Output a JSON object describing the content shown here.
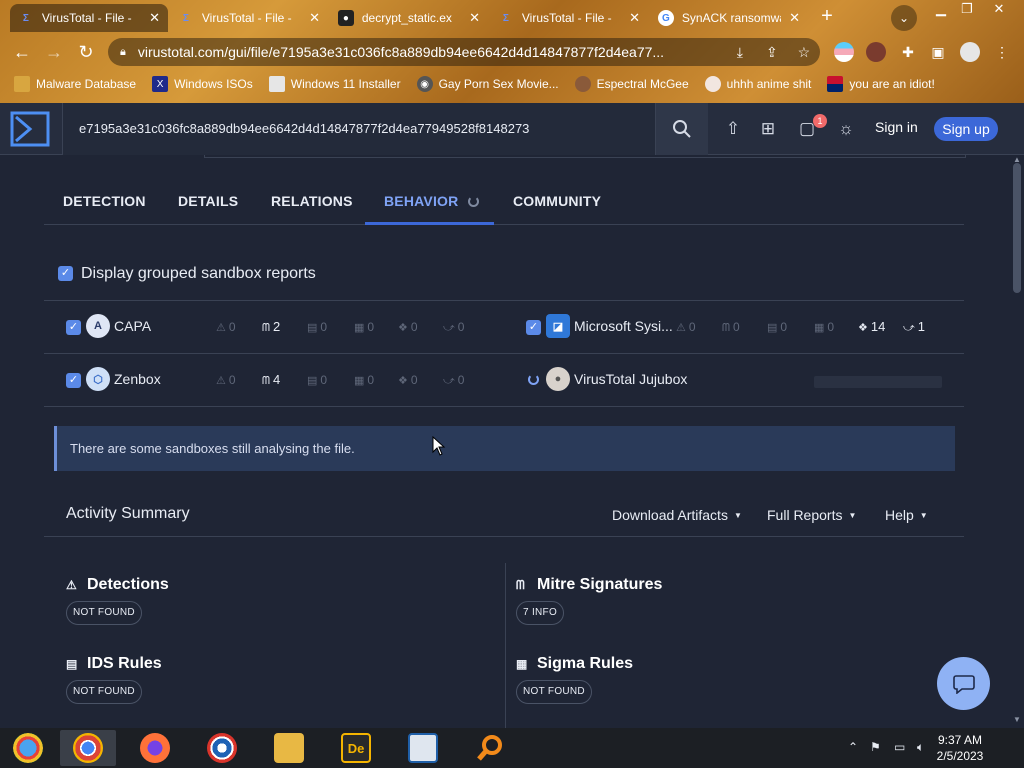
{
  "browser": {
    "tabs": [
      {
        "title": "VirusTotal - File -",
        "icon": "virustotal-icon",
        "close": "✕"
      },
      {
        "title": "VirusTotal - File -",
        "icon": "virustotal-icon",
        "close": "✕"
      },
      {
        "title": "decrypt_static.ex",
        "icon": "github-icon",
        "close": "✕"
      },
      {
        "title": "VirusTotal - File -",
        "icon": "virustotal-icon",
        "close": "✕"
      },
      {
        "title": "SynACK ransomwa",
        "icon": "google-icon",
        "close": "✕"
      }
    ],
    "new_tab": "+",
    "url": "virustotal.com/gui/file/e7195a3e31c036fc8a889db94ee6642d4d14847877f2d4ea77...",
    "bookmarks": [
      {
        "label": "Malware Database",
        "icon": "folder-icon"
      },
      {
        "label": "Windows ISOs",
        "icon": "x-icon"
      },
      {
        "label": "Windows 11 Installer",
        "icon": "image-icon"
      },
      {
        "label": "Gay Porn Sex Movie...",
        "icon": "globe-icon"
      },
      {
        "label": "Espectral McGee",
        "icon": "avatar-icon"
      },
      {
        "label": "uhhh anime shit",
        "icon": "anime-icon"
      },
      {
        "label": "you are an idiot!",
        "icon": "flag-icon"
      }
    ]
  },
  "vt": {
    "search_value": "e7195a3e31c036fc8a889db94ee6642d4d14847877f2d4ea77949528f8148273",
    "notification_count": "1",
    "signin": "Sign in",
    "signup": "Sign up",
    "tabs": [
      "DETECTION",
      "DETAILS",
      "RELATIONS",
      "BEHAVIOR",
      "COMMUNITY"
    ],
    "active_tab": "BEHAVIOR",
    "group_label": "Display grouped sandbox reports",
    "sandboxes": [
      {
        "name": "CAPA",
        "icon": "capa-icon",
        "stats": [
          "0",
          "2",
          "0",
          "0",
          "0",
          "0"
        ]
      },
      {
        "name": "Microsoft Sysi...",
        "icon": "microsoft-sysinternals-icon",
        "stats": [
          "0",
          "0",
          "0",
          "0",
          "14",
          "1"
        ]
      },
      {
        "name": "Zenbox",
        "icon": "zenbox-icon",
        "stats": [
          "0",
          "4",
          "0",
          "0",
          "0",
          "0"
        ]
      },
      {
        "name": "VirusTotal Jujubox",
        "icon": "jujubox-icon",
        "stats": []
      }
    ],
    "alert": "There are some sandboxes still analysing the file.",
    "activity": {
      "title": "Activity Summary",
      "download": "Download Artifacts",
      "full_reports": "Full Reports",
      "help": "Help"
    },
    "sections": [
      {
        "title": "Detections",
        "badge": "NOT FOUND",
        "icon": "warning-icon"
      },
      {
        "title": "Mitre Signatures",
        "badge": "7 INFO",
        "icon": "mitre-icon"
      },
      {
        "title": "IDS Rules",
        "badge": "NOT FOUND",
        "icon": "ids-icon"
      },
      {
        "title": "Sigma Rules",
        "badge": "NOT FOUND",
        "icon": "sigma-icon"
      }
    ]
  },
  "taskbar": {
    "time": "9:37 AM",
    "date": "2/5/2023"
  },
  "colors": {
    "accent": "#3c68d8",
    "active_tab": "#7fa3f5",
    "page_bg": "#1f2535",
    "alert_bg": "#2a3a59"
  }
}
